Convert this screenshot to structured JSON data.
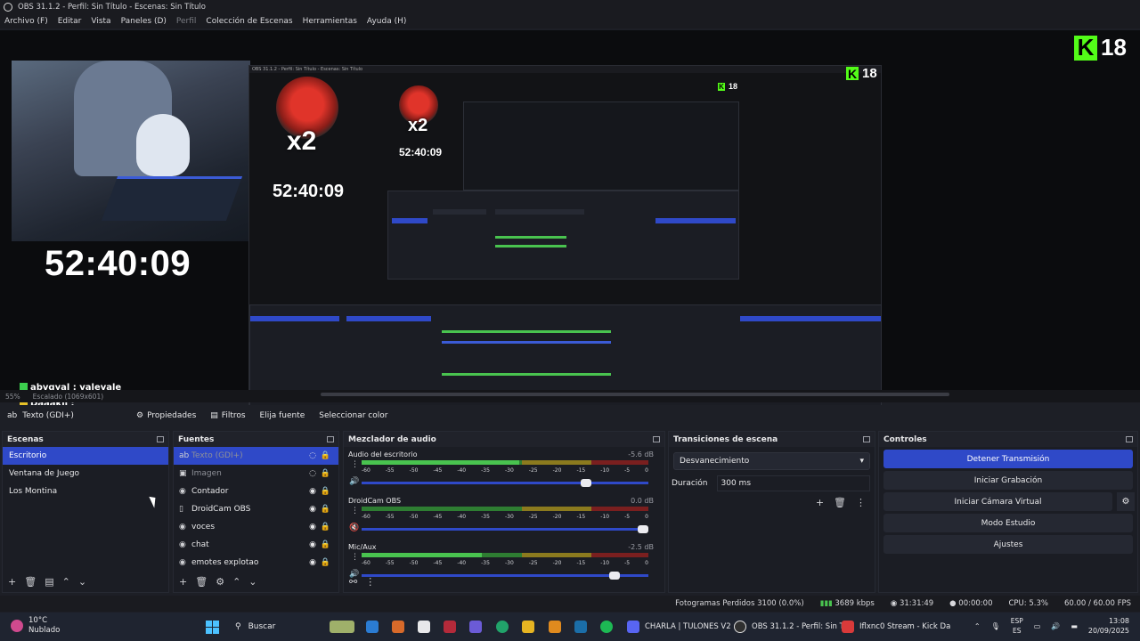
{
  "window": {
    "title": "OBS 31.1.2 - Perfil: Sin Título - Escenas: Sin Título"
  },
  "menu": [
    "Archivo (F)",
    "Editar",
    "Vista",
    "Paneles (D)",
    "Perfil",
    "Colección de Escenas",
    "Herramientas",
    "Ayuda (H)"
  ],
  "preview": {
    "timer_big": "52:40:09",
    "timer_mid": "52:40:09",
    "timer_small": "52:40:09",
    "multiplier": "x2",
    "kick_count": "18",
    "kick_letter": "K",
    "chat": [
      {
        "user": "abvgyal",
        "message": "valevale"
      },
      {
        "user": "Daaakii",
        "message": ""
      }
    ]
  },
  "zoom": {
    "level": "55%",
    "mode": "Escalado (1069x601)"
  },
  "source_toolbar": {
    "current": "Texto (GDI+)",
    "buttons": [
      "Propiedades",
      "Filtros",
      "Elija fuente",
      "Seleccionar color"
    ]
  },
  "scenes": {
    "title": "Escenas",
    "items": [
      "Escritorio",
      "Ventana de Juego",
      "Los Montina"
    ],
    "selected": 0
  },
  "sources": {
    "title": "Fuentes",
    "items": [
      {
        "label": "Texto (GDI+)",
        "icon": "text-icon",
        "visible": false,
        "selected": true
      },
      {
        "label": "Imagen",
        "icon": "image-icon",
        "visible": false
      },
      {
        "label": "Contador",
        "icon": "globe-icon",
        "visible": true
      },
      {
        "label": "DroidCam OBS",
        "icon": "page-icon",
        "visible": true
      },
      {
        "label": "voces",
        "icon": "globe-icon",
        "visible": true
      },
      {
        "label": "chat",
        "icon": "globe-icon",
        "visible": true
      },
      {
        "label": "emotes explotao",
        "icon": "globe-icon",
        "visible": true
      }
    ]
  },
  "mixer": {
    "title": "Mezclador de audio",
    "ticks": [
      "-60",
      "-55",
      "-50",
      "-45",
      "-40",
      "-35",
      "-30",
      "-25",
      "-20",
      "-15",
      "-10",
      "-5",
      "0"
    ],
    "channels": [
      {
        "name": "Audio del escritorio",
        "db": "-5.6 dB",
        "level": 0.55,
        "fader": 0.8,
        "muted": false
      },
      {
        "name": "DroidCam OBS",
        "db": "0.0 dB",
        "level": 0.0,
        "fader": 1.0,
        "muted": true
      },
      {
        "name": "Mic/Aux",
        "db": "-2.5 dB",
        "level": 0.42,
        "fader": 0.9,
        "muted": false
      }
    ]
  },
  "transitions": {
    "title": "Transiciones de escena",
    "selected": "Desvanecimiento",
    "duration_label": "Duración",
    "duration_value": "300 ms"
  },
  "controls": {
    "title": "Controles",
    "buttons": [
      "Detener Transmisión",
      "Iniciar Grabación",
      "Iniciar Cámara Virtual",
      "Modo Estudio",
      "Ajustes"
    ]
  },
  "status": {
    "dropped": "Fotogramas Perdidos 3100 (0.0%)",
    "bitrate": "3689 kbps",
    "stream_time": "31:31:49",
    "rec_time": "00:00:00",
    "cpu": "CPU: 5.3%",
    "fps": "60.00 / 60.00 FPS"
  },
  "taskbar": {
    "weather_temp": "10°C",
    "weather_desc": "Nublado",
    "search": "Buscar",
    "apps": [
      "CHARLA | TULONES V2",
      "OBS 31.1.2 - Perfil: Sin Tí",
      "Iflxnc0 Stream - Kick Da"
    ],
    "lang": "ESP",
    "lang2": "ES",
    "time": "13:08",
    "date": "20/09/2025"
  },
  "colors": {
    "accent": "#2f49c8",
    "kick": "#53fc18",
    "bg": "#1d1f26"
  }
}
